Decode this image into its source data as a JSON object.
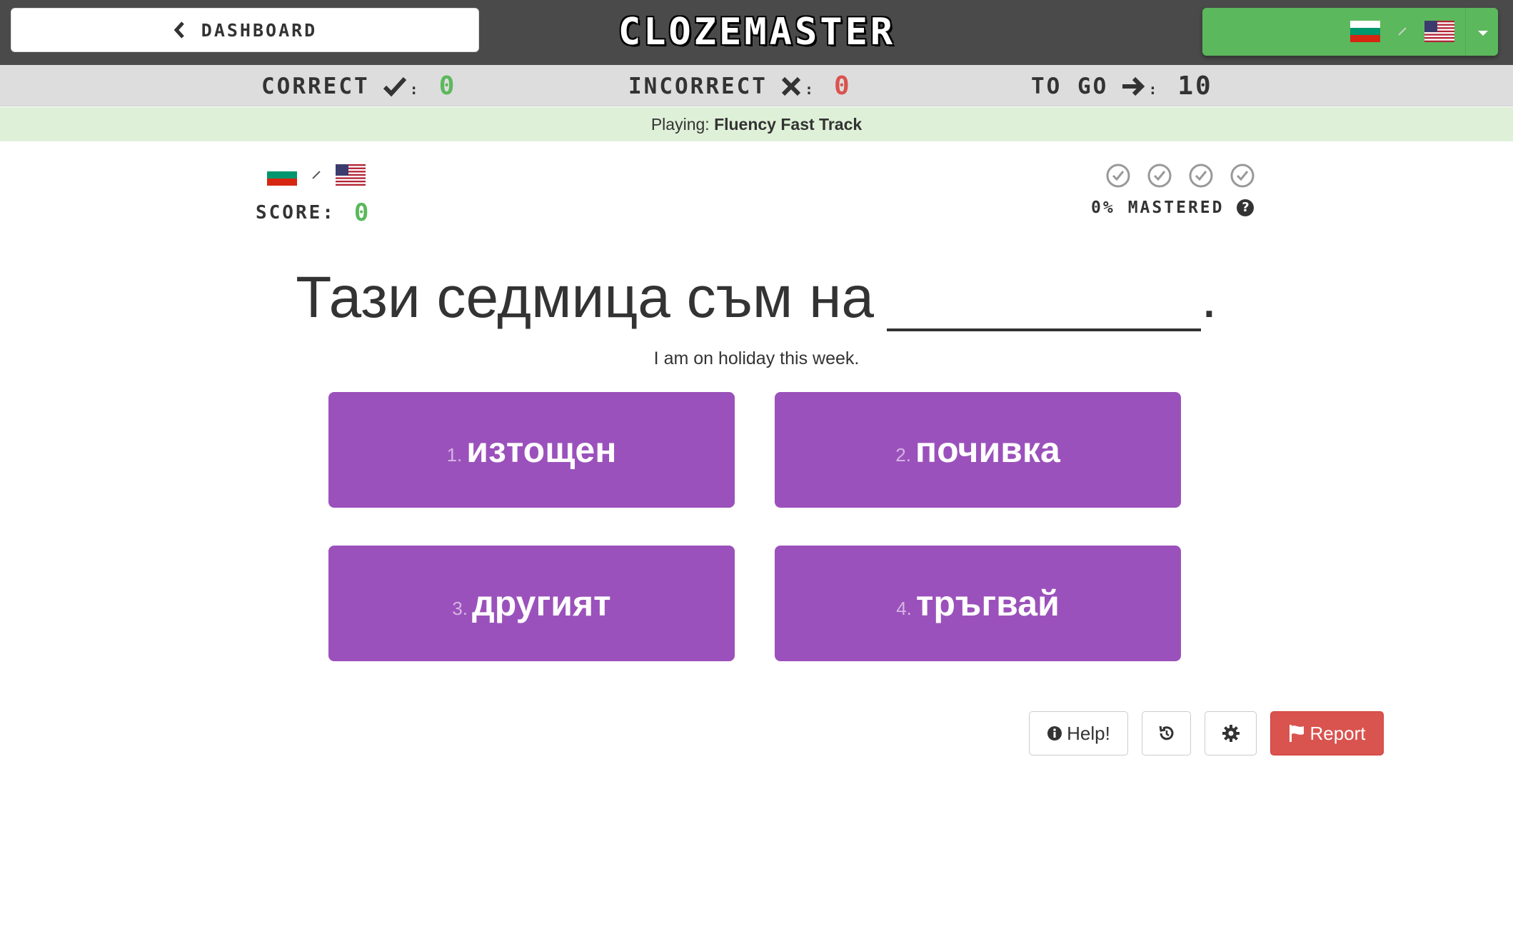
{
  "header": {
    "dashboard_label": "DASHBOARD",
    "logo": "CLOZEMASTER",
    "language_pair": {
      "from": "Bulgarian",
      "to": "English (US)"
    }
  },
  "stats": {
    "correct_label": "CORRECT",
    "correct_value": "0",
    "incorrect_label": "INCORRECT",
    "incorrect_value": "0",
    "togo_label": "TO GO",
    "togo_value": "10"
  },
  "playing": {
    "prefix": "Playing:",
    "mode": "Fluency Fast Track"
  },
  "score": {
    "label": "SCORE:",
    "value": "0"
  },
  "mastery": {
    "percent": "0%",
    "label": "MASTERED",
    "checks_total": 4,
    "checks_done": 0
  },
  "question": {
    "sentence_before": "Тази седмица съм на",
    "sentence_after": ".",
    "translation": "I am on holiday this week."
  },
  "choices": [
    {
      "num": "1.",
      "word": "изтощен"
    },
    {
      "num": "2.",
      "word": "почивка"
    },
    {
      "num": "3.",
      "word": "другият"
    },
    {
      "num": "4.",
      "word": "тръгвай"
    }
  ],
  "footer": {
    "help_label": "Help!",
    "report_label": "Report"
  },
  "colors": {
    "choice_bg": "#9b51bb",
    "correct_green": "#5cb85c",
    "incorrect_red": "#d9534f",
    "topbar": "#4a4a4a"
  }
}
